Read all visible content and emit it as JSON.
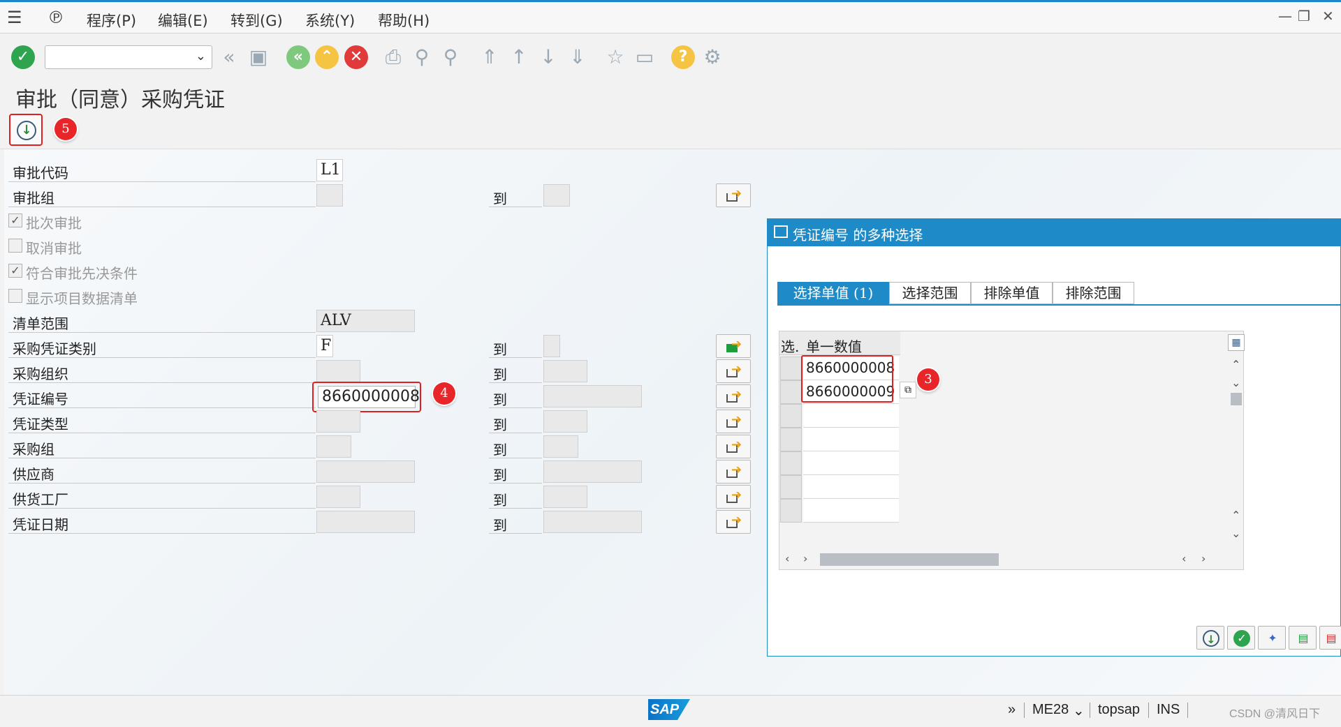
{
  "menubar": {
    "items": [
      "程序(P)",
      "编辑(E)",
      "转到(G)",
      "系统(Y)",
      "帮助(H)"
    ]
  },
  "toolbar": {
    "command_value": "",
    "icons": [
      "enter-icon",
      "back-icon",
      "save-icon",
      "back-circle-icon",
      "exit-icon",
      "cancel-icon",
      "print-icon",
      "find-icon",
      "find-next-icon",
      "first-page-icon",
      "prev-page-icon",
      "next-page-icon",
      "last-page-icon",
      "create-session-icon",
      "shortcut-icon",
      "help-icon",
      "settings-icon"
    ]
  },
  "page": {
    "title": "审批（同意）采购凭证"
  },
  "callouts": {
    "c5": "5",
    "c4": "4",
    "c3": "3"
  },
  "form": {
    "to_label": "到",
    "fields": [
      {
        "label": "审批代码",
        "value": "L1"
      },
      {
        "label": "审批组",
        "value": ""
      },
      {
        "label": "清单范围",
        "value": "ALV"
      },
      {
        "label": "采购凭证类别",
        "value": "F"
      },
      {
        "label": "采购组织",
        "value": ""
      },
      {
        "label": "凭证编号",
        "value": "8660000008"
      },
      {
        "label": "凭证类型",
        "value": ""
      },
      {
        "label": "采购组",
        "value": ""
      },
      {
        "label": "供应商",
        "value": ""
      },
      {
        "label": "供货工厂",
        "value": ""
      },
      {
        "label": "凭证日期",
        "value": ""
      }
    ],
    "checkboxes": [
      {
        "label": "批次审批",
        "checked": true
      },
      {
        "label": "取消审批",
        "checked": false
      },
      {
        "label": "符合审批先决条件",
        "checked": true
      },
      {
        "label": "显示项目数据清单",
        "checked": false
      }
    ]
  },
  "dialog": {
    "title": "凭证编号 的多种选择",
    "tabs": [
      "选择单值 (1)",
      "选择范围",
      "排除单值",
      "排除范围"
    ],
    "grid": {
      "col_select": "选.",
      "col_value": "单一数值",
      "rows": [
        "8660000008",
        "8660000009",
        "",
        "",
        "",
        "",
        ""
      ]
    }
  },
  "statusbar": {
    "more": "»",
    "transaction": "ME28",
    "system": "topsap",
    "mode": "INS",
    "watermark": "CSDN @清风日下"
  },
  "colors": {
    "accent": "#1f8ac8",
    "highlight": "#e02020",
    "ok_green": "#2ea44f",
    "cancel_red": "#e03a3a",
    "help_yellow": "#f6c443"
  }
}
